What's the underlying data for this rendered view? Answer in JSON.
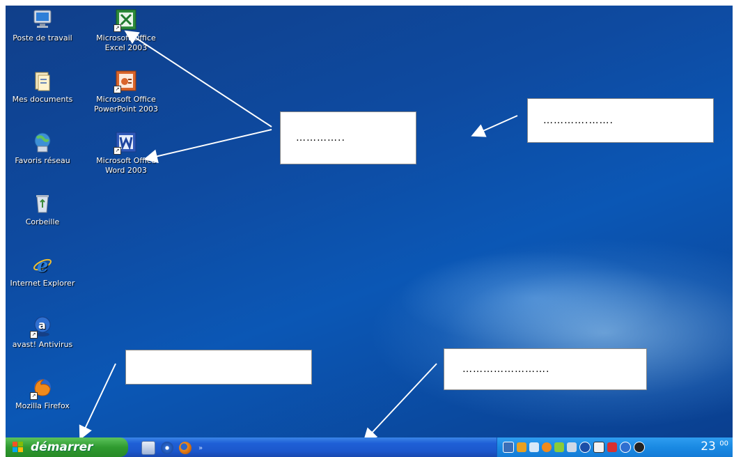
{
  "desktop": {
    "icons": [
      {
        "label": "Poste de travail",
        "icon": "computer-icon",
        "shortcut": false
      },
      {
        "label": "Microsoft Office Excel 2003",
        "icon": "excel-icon",
        "shortcut": true
      },
      {
        "label": "Mes documents",
        "icon": "documents-icon",
        "shortcut": false
      },
      {
        "label": "Microsoft Office PowerPoint 2003",
        "icon": "powerpoint-icon",
        "shortcut": true
      },
      {
        "label": "Favoris réseau",
        "icon": "network-icon",
        "shortcut": false
      },
      {
        "label": "Microsoft Office Word 2003",
        "icon": "word-icon",
        "shortcut": true
      },
      {
        "label": "Corbeille",
        "icon": "recycle-bin-icon",
        "shortcut": false
      },
      {
        "label": "Internet Explorer",
        "icon": "internet-explorer-icon",
        "shortcut": false
      },
      {
        "label": "avast! Antivirus",
        "icon": "avast-icon",
        "shortcut": true
      },
      {
        "label": "Mozilla Firefox",
        "icon": "firefox-icon",
        "shortcut": true
      }
    ]
  },
  "callouts": {
    "icons_box": "…………..",
    "background_box": "………….…….",
    "start_box": "",
    "taskbar_box": "……………………."
  },
  "taskbar": {
    "start_label": "démarrer",
    "quick_launch": [
      "show-desktop-icon",
      "media-player-icon",
      "firefox-icon"
    ],
    "overflow": "»",
    "clock_hour": "23",
    "clock_minutes": "00"
  },
  "colors": {
    "desktop_blue": "#0e4aa0",
    "taskbar_blue": "#1f5fd6",
    "start_green": "#2f9a2f"
  }
}
